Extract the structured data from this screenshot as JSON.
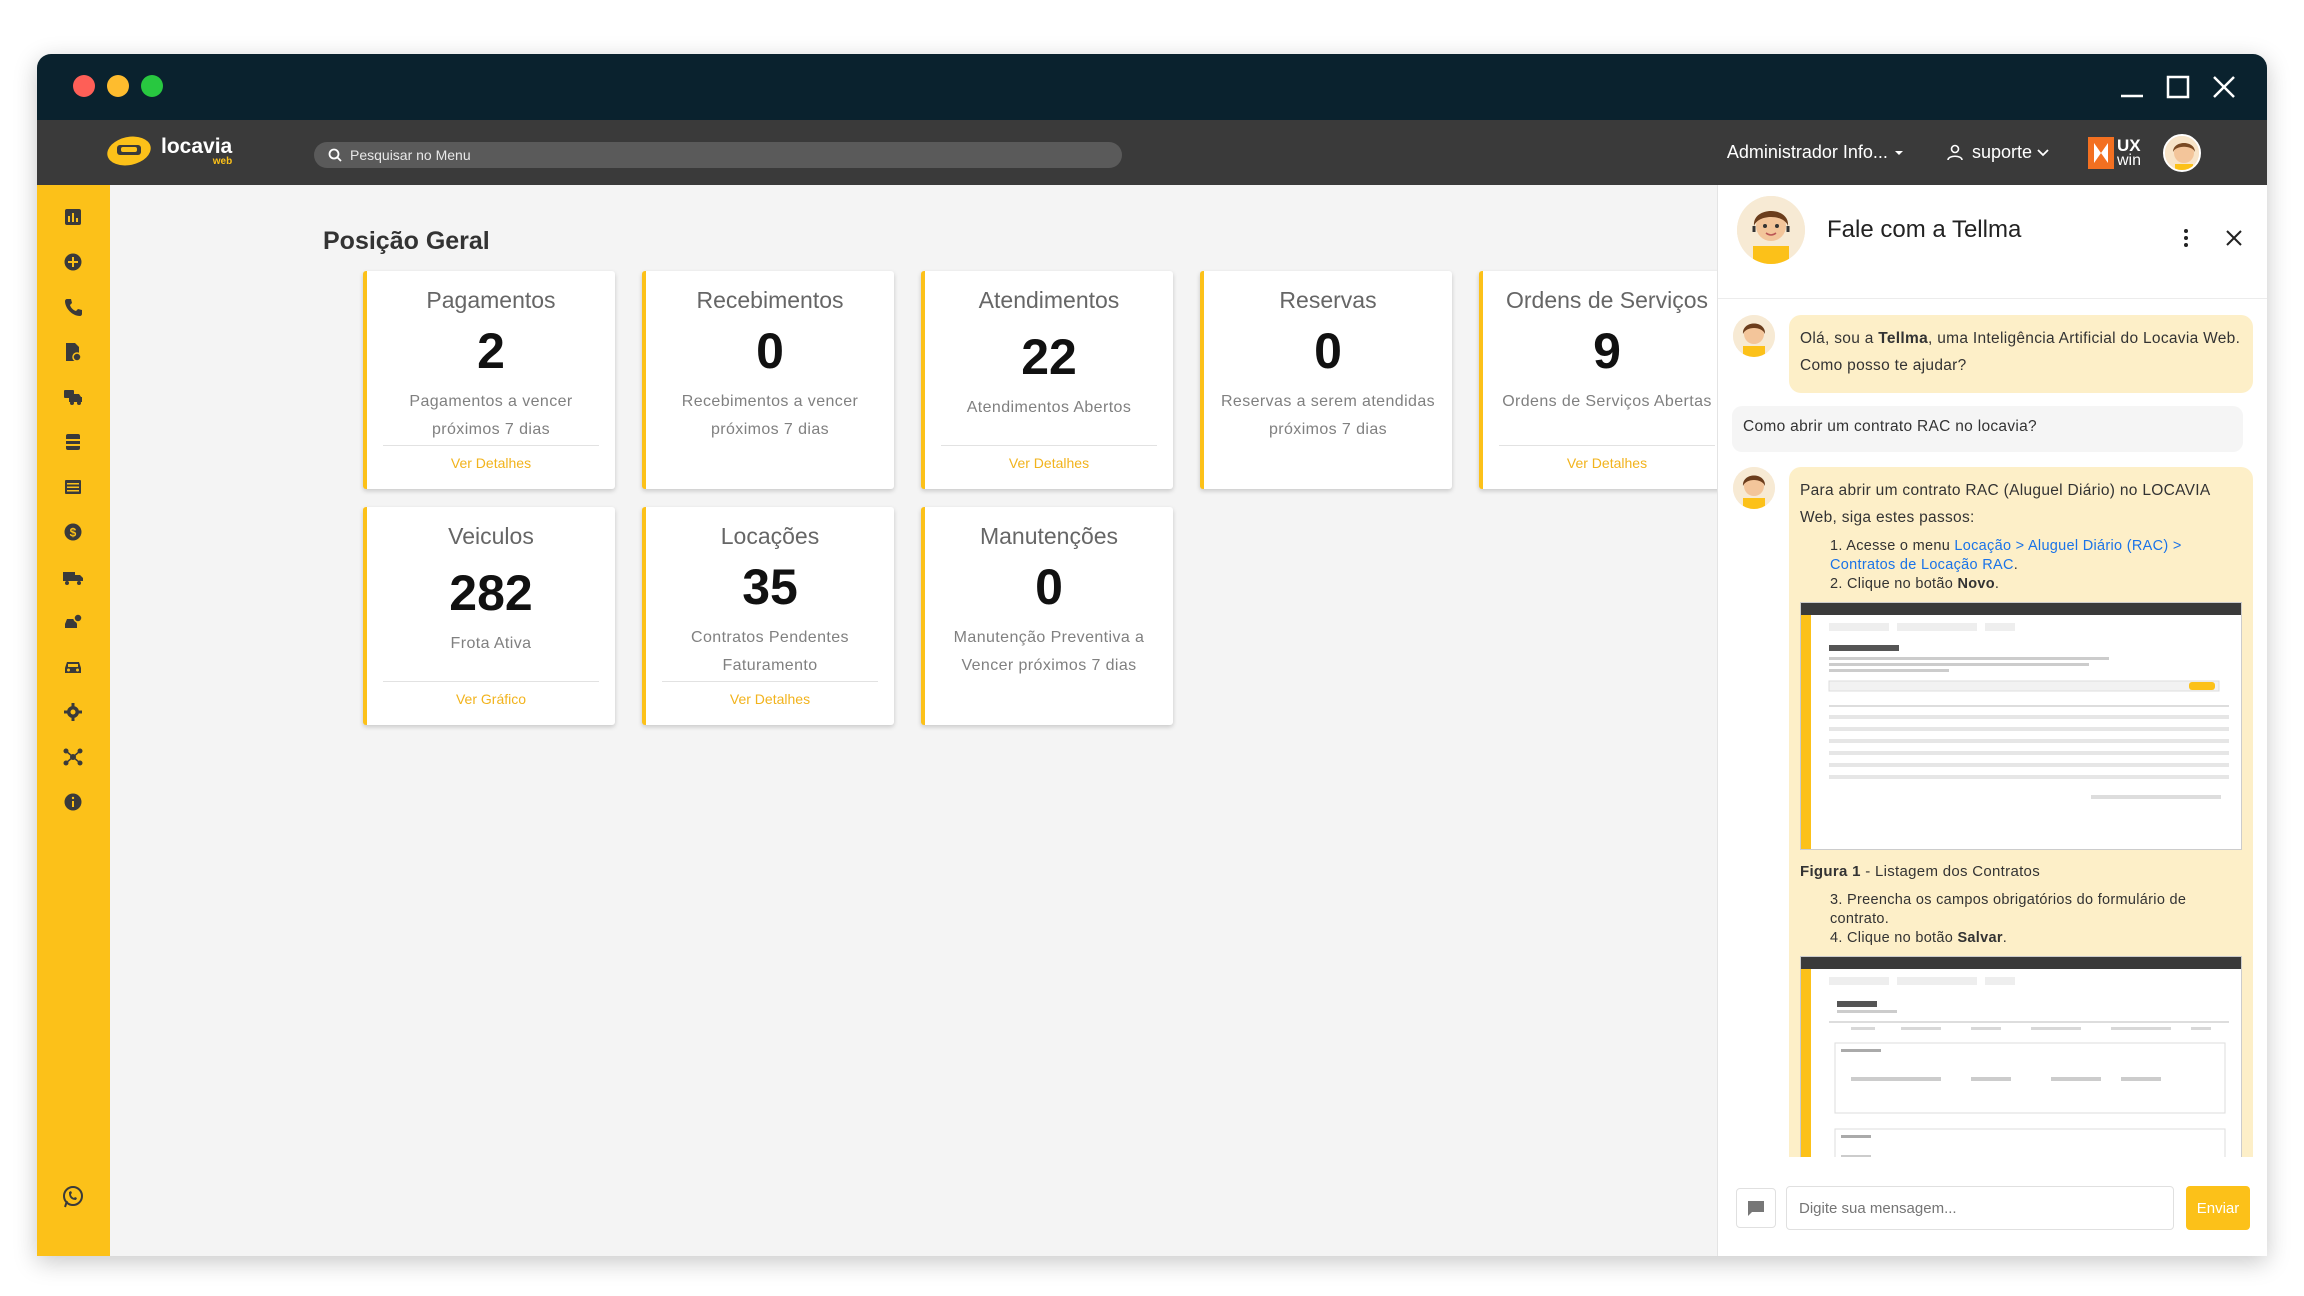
{
  "app": {
    "logo_text": "locavia",
    "logo_sub": "web",
    "search_placeholder": "Pesquisar no Menu",
    "admin_label": "Administrador Info...",
    "user_label": "suporte",
    "ux_label": "UX",
    "win_label": "win"
  },
  "main": {
    "title": "Posição Geral",
    "cards": [
      {
        "title": "Pagamentos",
        "value": "2",
        "desc": "Pagamentos a vencer próximos 7 dias",
        "link": "Ver Detalhes"
      },
      {
        "title": "Recebimentos",
        "value": "0",
        "desc": "Recebimentos a vencer próximos 7 dias",
        "link": ""
      },
      {
        "title": "Atendimentos",
        "value": "22",
        "desc": "Atendimentos Abertos",
        "link": "Ver Detalhes"
      },
      {
        "title": "Reservas",
        "value": "0",
        "desc": "Reservas a serem atendidas próximos 7 dias",
        "link": ""
      },
      {
        "title": "Ordens de Serviços",
        "value": "9",
        "desc": "Ordens de Serviços Abertas",
        "link": "Ver Detalhes"
      },
      {
        "title": "Veiculos",
        "value": "282",
        "desc": "Frota Ativa",
        "link": "Ver Gráfico"
      },
      {
        "title": "Locações",
        "value": "35",
        "desc": "Contratos Pendentes Faturamento",
        "link": "Ver Detalhes"
      },
      {
        "title": "Manutenções",
        "value": "0",
        "desc": "Manutenção Preventiva a Vencer próximos 7 dias",
        "link": ""
      }
    ]
  },
  "chat": {
    "title": "Fale com a Tellma",
    "msg1_pre": "Olá, sou a ",
    "msg1_bold": "Tellma",
    "msg1_post": ", uma Inteligência Artificial do Locavia Web. Como posso te ajudar?",
    "user_msg": "Como abrir um contrato RAC no locavia?",
    "ai_intro": "Para abrir um contrato RAC (Aluguel Diário) no LOCAVIA Web, siga estes passos:",
    "step1_pre": "Acesse o menu ",
    "step1_link": "Locação > Aluguel Diário (RAC) > Contratos de Locação RAC",
    "step1_post": ".",
    "step2_pre": "Clique no botão ",
    "step2_bold": "Novo",
    "step2_post": ".",
    "fig1_bold": "Figura 1",
    "fig1_text": " - Listagem dos Contratos",
    "step3": "Preencha os campos obrigatórios do formulário de contrato.",
    "step4_pre": "Clique no botão ",
    "step4_bold": "Salvar",
    "step4_post": ".",
    "input_placeholder": "Digite sua mensagem...",
    "send_label": "Enviar"
  },
  "colors": {
    "accent": "#fcc119",
    "titlebar": "#0a222e",
    "appbar": "#3a3a3a",
    "link": "#f2b31c"
  }
}
